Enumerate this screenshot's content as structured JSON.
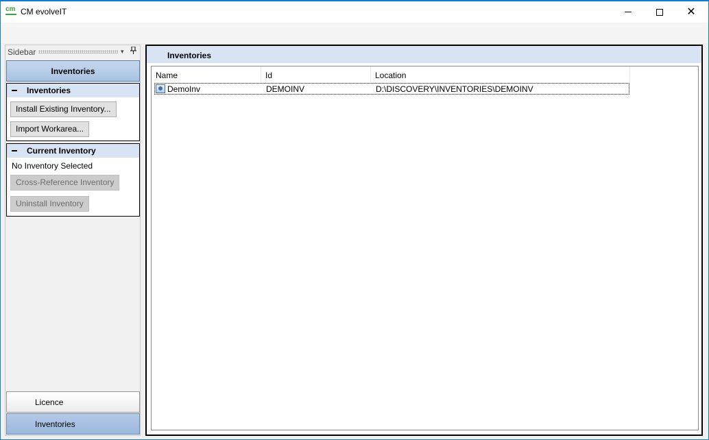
{
  "window": {
    "icon_text": "cm",
    "title": "CM evolveIT",
    "minimize": "–",
    "maximize": "□",
    "close": "✕"
  },
  "sidebar": {
    "label": "Sidebar",
    "dropdown_icon": "▾",
    "pin_icon": "📌",
    "header_button": "Inventories",
    "inventories_panel": {
      "title": "Inventories",
      "buttons": [
        "Install Existing Inventory...",
        "Import Workarea..."
      ]
    },
    "current_inventory_panel": {
      "title": "Current Inventory",
      "status": "No Inventory Selected",
      "buttons": [
        "Cross-Reference Inventory",
        "Uninstall Inventory"
      ]
    },
    "bottom_items": [
      "Licence",
      "Inventories"
    ]
  },
  "main": {
    "title": "Inventories",
    "columns": [
      "Name",
      "Id",
      "Location"
    ],
    "rows": [
      {
        "name": "DemoInv",
        "id": "DEMOINV",
        "location": "D:\\DISCOVERY\\INVENTORIES\\DEMOINV"
      }
    ]
  }
}
